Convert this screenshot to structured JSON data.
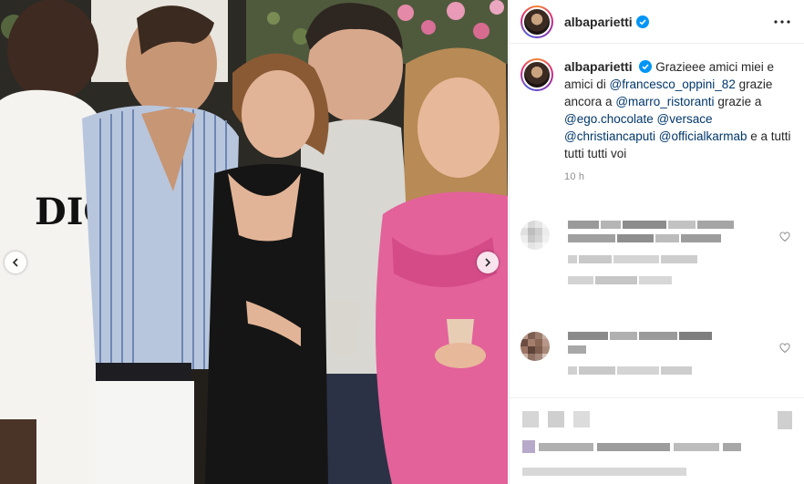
{
  "post": {
    "username": "albaparietti",
    "verified": true,
    "caption_text_1": "Grazieee amici miei e amici di",
    "mention_1": "@francesco_oppini_82",
    "caption_text_2": "grazie ancora a",
    "mention_2": "@marro_ristoranti",
    "caption_text_3": "grazie a",
    "mention_3": "@ego.chocolate",
    "mention_4": "@versace",
    "mention_5": "@christiancaputi",
    "mention_6": "@officialkarmab",
    "caption_text_4": "e a tutti tutti tutti voi",
    "time_ago": "10 h"
  },
  "photo_text": {
    "shirt_print": "DIO"
  },
  "icons": {
    "verified": "verified-badge-icon",
    "more": "more-options-icon",
    "prev": "chevron-left-icon",
    "next": "chevron-right-icon",
    "heart": "heart-icon"
  },
  "colors": {
    "verified_blue": "#0095f6",
    "mention_blue": "#00376b",
    "timestamp_gray": "#8e8e8e"
  }
}
